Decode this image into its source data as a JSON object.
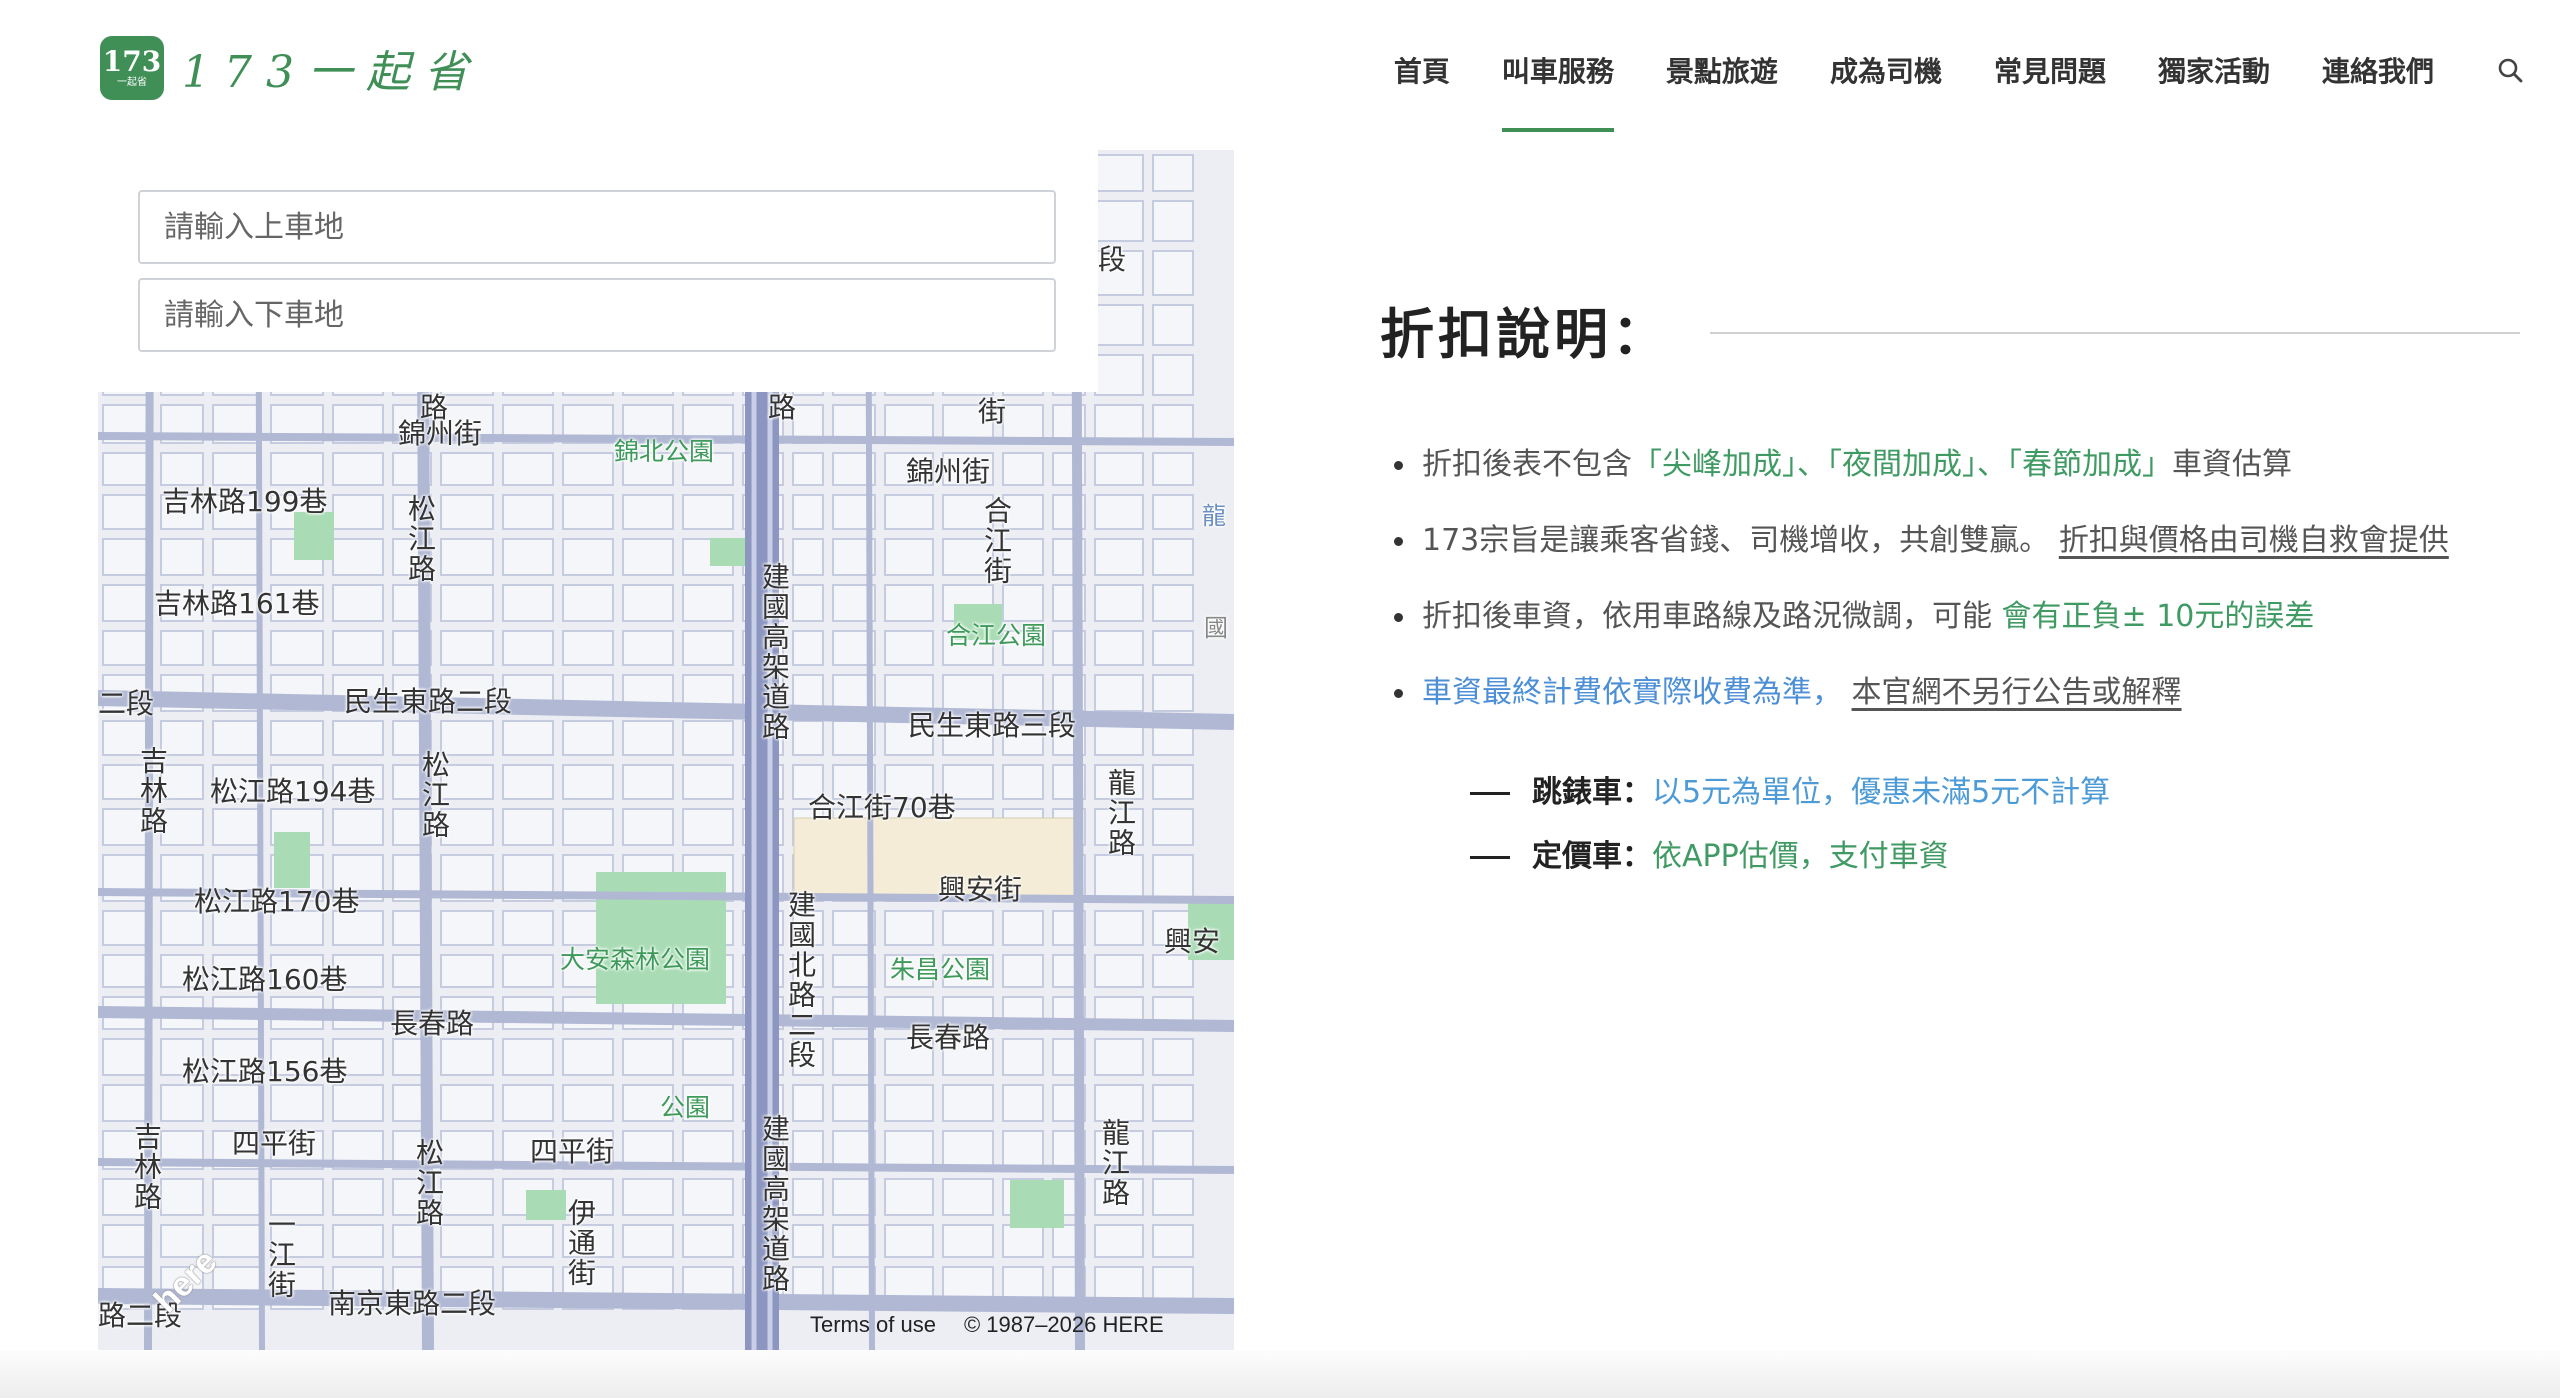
{
  "header": {
    "logo_number": "173",
    "logo_small": "一起省",
    "logo_text": "173一起省",
    "nav": [
      "首頁",
      "叫車服務",
      "景點旅遊",
      "成為司機",
      "常見問題",
      "獨家活動",
      "連絡我們"
    ],
    "active_nav": 1
  },
  "search": {
    "pickup_placeholder": "請輸入上車地",
    "dropoff_placeholder": "請輸入下車地"
  },
  "map": {
    "labels": {
      "jilin_199": "吉林路199巷",
      "jilin_161": "吉林路161巷",
      "jinzhou_w": "錦州街",
      "jinzhou_e": "錦州街",
      "jinbei_park": "錦北公園",
      "songjiang_1": "松江路",
      "songjiang_2": "松江路",
      "songjiang_3": "松江路",
      "minsheng_2": "民生東路二段",
      "minsheng_3": "民生東路三段",
      "erduan_left": "二段",
      "jilin_1": "吉林路",
      "jilin_2": "吉林路",
      "songjiang_194": "松江路194巷",
      "songjiang_170": "松江路170巷",
      "songjiang_160": "松江路160巷",
      "songjiang_156": "松江路156巷",
      "jianguo_elev_1": "建國高架道路",
      "jianguo_elev_2": "建國高架道路",
      "jianguo_n": "建國北路二段",
      "hejiang_st": "合江街",
      "hejiang_park": "合江公園",
      "hejiang_70": "合江街70巷",
      "longjiang_1": "龍江路",
      "longjiang_2": "龍江路",
      "xingan_1": "興安街",
      "xingan_2": "興安",
      "zhuchang_park": "朱昌公園",
      "daan_park": "大安森林公園",
      "changchun_1": "長春路",
      "changchun_2": "長春路",
      "park": "公園",
      "siping_1": "四平街",
      "siping_2": "四平街",
      "yitong": "伊通街",
      "yijiang": "一江街",
      "nanjing": "南京東路二段",
      "lu_erduan": "路二段",
      "duan_top": "段",
      "lu_top1": "路",
      "lu_top2": "路",
      "jie_top": "街",
      "long_edge": "龍",
      "guo_edge": "國"
    },
    "attribution_terms": "Terms of use",
    "attribution_copy": "© 1987–2026 HERE",
    "here_logo": "here"
  },
  "discount": {
    "title": "折扣說明：",
    "item1": {
      "a": "折扣後表不包含",
      "b": "「尖峰加成」、「夜間加成」、「春節加成」",
      "c": "車資估算"
    },
    "item2": {
      "a": "173宗旨是讓乘客省錢、司機增收，共創雙贏。",
      "b": "折扣與價格由司機自救會提供"
    },
    "item3": {
      "a": "折扣後車資，依用車路線及路況微調，可能",
      "b": "會有正負± 10元的誤差"
    },
    "item4": {
      "a": "車資最終計費依實際收費為準，",
      "b": "本官網不另行公告或解釋"
    },
    "meter": {
      "label": "跳錶車：",
      "value": "以5元為單位，優惠未滿5元不計算"
    },
    "fixed": {
      "label": "定價車：",
      "value": "依APP估價，支付車資"
    }
  }
}
